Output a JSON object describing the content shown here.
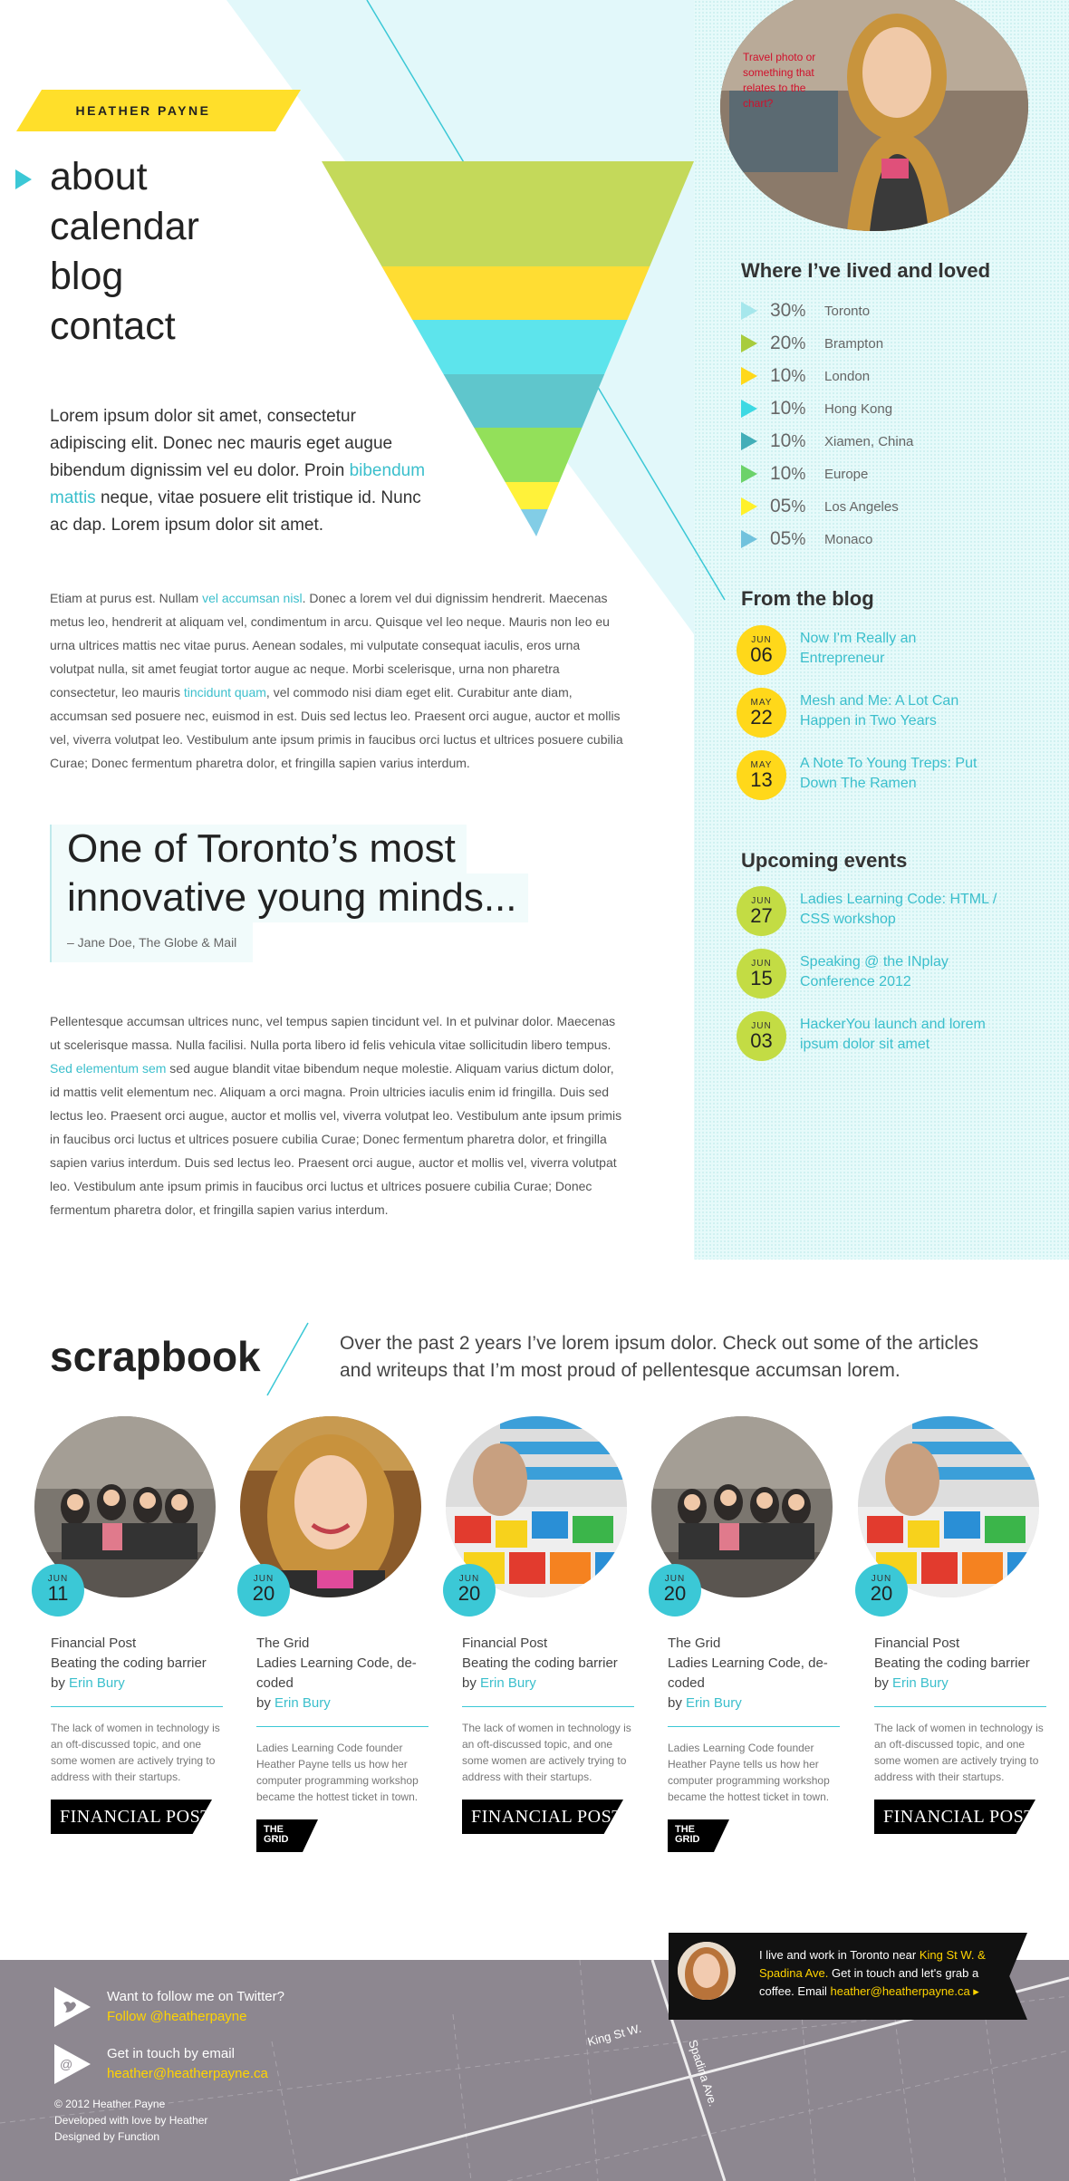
{
  "brand": {
    "name": "HEATHER PAYNE"
  },
  "nav": [
    {
      "label": "about"
    },
    {
      "label": "calendar"
    },
    {
      "label": "blog"
    },
    {
      "label": "contact"
    }
  ],
  "hero_photo": {
    "caption": "Travel photo or something that relates to the chart?"
  },
  "intro": {
    "before": "Lorem ipsum dolor sit amet, consectetur adipiscing elit. Donec nec mauris eget augue bibendum dignissim vel eu dolor. Proin ",
    "link": "bibendum mattis",
    "after": " neque, vitae posuere elit tristique id. Nunc ac dap. Lorem ipsum dolor sit amet."
  },
  "body1": {
    "p1": "Etiam at purus est. Nullam ",
    "link1": "vel accumsan nisl",
    "p2": ". Donec a lorem vel dui dignissim hendrerit. Maecenas metus leo, hendrerit at aliquam vel, condimentum in arcu. Quisque vel leo neque. Mauris non leo eu urna ultrices mattis nec vitae purus. Aenean sodales, mi vulputate consequat iaculis, eros urna volutpat nulla, sit amet feugiat tortor augue ac neque. Morbi scelerisque, urna non pharetra consectetur, leo mauris ",
    "link2": "tincidunt quam",
    "p3": ", vel commodo nisi diam eget elit. Curabitur ante diam, accumsan sed posuere nec, euismod in est. Duis sed lectus leo. Praesent orci augue, auctor et mollis vel, viverra volutpat leo. Vestibulum ante ipsum primis in faucibus orci luctus et ultrices posuere cubilia Curae; Donec fermentum pharetra dolor, et fringilla sapien varius interdum."
  },
  "quote": {
    "line1": "One of Toronto’s most",
    "line2": "innovative young minds...",
    "source": "– Jane Doe, The Globe & Mail"
  },
  "body2": {
    "p1": "Pellentesque accumsan ultrices nunc, vel tempus sapien tincidunt vel. In et pulvinar dolor. Maecenas ut scelerisque massa. Nulla facilisi. Nulla porta libero id felis vehicula vitae sollicitudin libero tempus. ",
    "link": "Sed elementum sem",
    "p2": " sed augue blandit vitae bibendum neque molestie. Aliquam varius dictum dolor, id mattis velit elementum nec. Aliquam a orci magna. Proin ultricies iaculis enim id fringilla. Duis sed lectus leo. Praesent orci augue, auctor et mollis vel, viverra volutpat leo. Vestibulum ante ipsum primis in faucibus orci luctus et ultrices posuere cubilia Curae; Donec fermentum pharetra dolor, et fringilla sapien varius interdum. Duis sed lectus leo. Praesent orci augue, auctor et mollis vel, viverra volutpat leo. Vestibulum ante ipsum primis in faucibus orci luctus et ultrices posuere cubilia Curae; Donec fermentum pharetra dolor, et fringilla sapien varius interdum."
  },
  "lived": {
    "title": "Where I’ve lived and loved",
    "items": [
      {
        "pct": "30",
        "place": "Toronto",
        "color": "#a6e7ec"
      },
      {
        "pct": "20",
        "place": "Brampton",
        "color": "#a8cc3c"
      },
      {
        "pct": "10",
        "place": "London",
        "color": "#ffd81a"
      },
      {
        "pct": "10",
        "place": "Hong Kong",
        "color": "#3dd9e3"
      },
      {
        "pct": "10",
        "place": "Xiamen, China",
        "color": "#43aeb8"
      },
      {
        "pct": "10",
        "place": "Europe",
        "color": "#6cd26a"
      },
      {
        "pct": "05",
        "place": "Los Angeles",
        "color": "#fff02a"
      },
      {
        "pct": "05",
        "place": "Monaco",
        "color": "#71c2dd"
      }
    ],
    "unit": "%"
  },
  "funnel_colors": [
    "#c4d95a",
    "#ffdd33",
    "#5de4ec",
    "#5fc6cc",
    "#93e05a",
    "#fff23a",
    "#82cde6"
  ],
  "blog": {
    "title": "From the blog",
    "items": [
      {
        "month": "JUN",
        "day": "06",
        "title": "Now I'm Really an Entrepreneur"
      },
      {
        "month": "MAY",
        "day": "22",
        "title": "Mesh and Me: A Lot Can Happen in Two Years"
      },
      {
        "month": "MAY",
        "day": "13",
        "title": "A Note To Young Treps: Put Down The Ramen"
      }
    ],
    "color": "#ffd81a"
  },
  "events": {
    "title": "Upcoming events",
    "items": [
      {
        "month": "JUN",
        "day": "27",
        "title": "Ladies Learning Code: HTML / CSS workshop"
      },
      {
        "month": "JUN",
        "day": "15",
        "title": "Speaking @ the INplay Conference 2012"
      },
      {
        "month": "JUN",
        "day": "03",
        "title": "HackerYou launch and lorem ipsum dolor sit amet"
      }
    ],
    "color": "#c3dc44"
  },
  "scrapbook": {
    "title": "scrapbook",
    "intro": "Over the past 2 years I’ve lorem ipsum dolor. Check out some of the articles and writeups that I’m most proud of pellentesque accumsan lorem.",
    "by_label": "by ",
    "cards": [
      {
        "month": "JUN",
        "day": "11",
        "outlet": "Financial Post",
        "headline": "Beating the coding barrier",
        "author": "Erin Bury",
        "desc": "The lack of women in technology is an oft-discussed topic, and one some women are actively trying to address with their startups.",
        "logo": "FINANCIAL POST",
        "photo": "group-photo"
      },
      {
        "month": "JUN",
        "day": "20",
        "outlet": "The Grid",
        "headline": "Ladies Learning Code, de-coded",
        "author": "Erin Bury",
        "desc": "Ladies Learning Code founder Heather Payne tells us how her computer programming workshop became the hottest ticket in town.",
        "logo": "THE GRID",
        "photo": "portrait-photo"
      },
      {
        "month": "JUN",
        "day": "20",
        "outlet": "Financial Post",
        "headline": "Beating the coding barrier",
        "author": "Erin Bury",
        "desc": "The lack of women in technology is an oft-discussed topic, and one some women are actively trying to address with their startups.",
        "logo": "FINANCIAL POST",
        "photo": "lego-photo"
      },
      {
        "month": "JUN",
        "day": "20",
        "outlet": "The Grid",
        "headline": "Ladies Learning Code, de-coded",
        "author": "Erin Bury",
        "desc": "Ladies Learning Code founder Heather Payne tells us how her computer programming workshop became the hottest ticket in town.",
        "logo": "THE GRID",
        "photo": "group-photo"
      },
      {
        "month": "JUN",
        "day": "20",
        "outlet": "Financial Post",
        "headline": "Beating the coding barrier",
        "author": "Erin Bury",
        "desc": "The lack of women in technology is an oft-discussed topic, and one some women are actively trying to address with their startups.",
        "logo": "FINANCIAL POST",
        "photo": "lego-photo"
      }
    ]
  },
  "footer": {
    "twitter_label": "Want to follow me on Twitter?",
    "twitter_link": "Follow @heatherpayne",
    "email_label": "Get in touch by email",
    "email_link": "heather@heatherpayne.ca",
    "copyright": "© 2012 Heather Payne",
    "developed": "Developed with love by Heather",
    "designed": "Designed by Function",
    "street1": "King St W.",
    "street2": "Spadina Ave."
  },
  "callout": {
    "t1": "I live and work in Toronto near ",
    "h1": "King St W. & Spadina Ave.",
    "t2": " Get in touch and let's grab a coffee. Email ",
    "h2": "heather@heatherpayne.ca ▸"
  },
  "colors": {
    "accent": "#3bbfcc",
    "yellow": "#ffd400",
    "panel": "#e6fafa"
  }
}
